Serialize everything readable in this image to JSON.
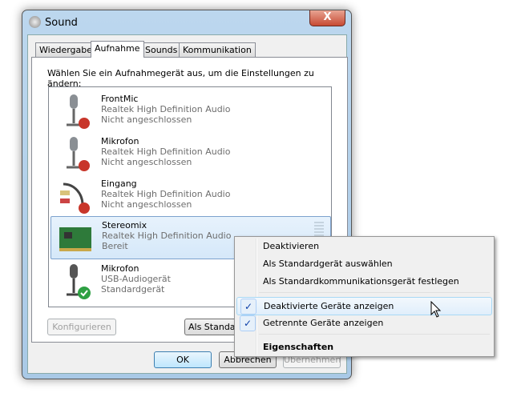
{
  "window": {
    "title": "Sound",
    "close_label": "X"
  },
  "tabs": [
    {
      "label": "Wiedergabe"
    },
    {
      "label": "Aufnahme"
    },
    {
      "label": "Sounds"
    },
    {
      "label": "Kommunikation"
    }
  ],
  "instruction": "Wählen Sie ein Aufnahmegerät aus, um die Einstellungen zu ändern:",
  "devices": [
    {
      "name": "FrontMic",
      "driver": "Realtek High Definition Audio",
      "status": "Nicht angeschlossen",
      "icon": "microphone-disconnected"
    },
    {
      "name": "Mikrofon",
      "driver": "Realtek High Definition Audio",
      "status": "Nicht angeschlossen",
      "icon": "microphone-disconnected"
    },
    {
      "name": "Eingang",
      "driver": "Realtek High Definition Audio",
      "status": "Nicht angeschlossen",
      "icon": "line-in-disconnected"
    },
    {
      "name": "Stereomix",
      "driver": "Realtek High Definition Audio",
      "status": "Bereit",
      "icon": "sound-card"
    },
    {
      "name": "Mikrofon",
      "driver": "USB-Audiogerät",
      "status": "Standardgerät",
      "icon": "microphone-default"
    }
  ],
  "buttons": {
    "configure": "Konfigurieren",
    "set_default": "Als Standard",
    "ok": "OK",
    "cancel": "Abbrechen",
    "apply": "Übernehmen"
  },
  "context_menu": {
    "items": [
      {
        "label": "Deaktivieren"
      },
      {
        "label": "Als Standardgerät auswählen"
      },
      {
        "label": "Als Standardkommunikationsgerät festlegen"
      },
      {
        "label": "Deaktivierte Geräte anzeigen",
        "checked": true
      },
      {
        "label": "Getrennte Geräte anzeigen",
        "checked": true
      },
      {
        "label": "Eigenschaften",
        "bold": true
      }
    ],
    "check_mark": "✓"
  }
}
